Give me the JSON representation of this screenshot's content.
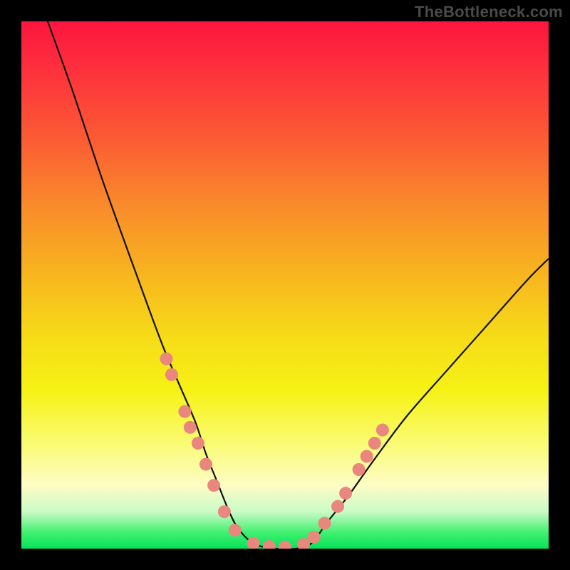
{
  "watermark": {
    "text": "TheBottleneck.com"
  },
  "colors": {
    "background": "#000000",
    "curve": "#111111",
    "marker_fill": "#e9867e",
    "marker_stroke": "#c25a52"
  },
  "chart_data": {
    "type": "line",
    "title": "",
    "xlabel": "",
    "ylabel": "",
    "xlim": [
      0,
      1
    ],
    "ylim": [
      0,
      100
    ],
    "grid": false,
    "legend": false,
    "note": "Axes are unlabeled in the source image; values below are estimated from pixel positions. x is normalized 0–1 across the plot width, y is bottleneck percentage (0 at bottom / green, 100 at top / red).",
    "series": [
      {
        "name": "bottleneck-curve",
        "x": [
          0.05,
          0.1,
          0.15,
          0.2,
          0.24,
          0.27,
          0.3,
          0.33,
          0.35,
          0.37,
          0.39,
          0.41,
          0.44,
          0.48,
          0.52,
          0.55,
          0.58,
          0.62,
          0.67,
          0.73,
          0.8,
          0.88,
          0.96,
          1.0
        ],
        "y": [
          100,
          86,
          71,
          57,
          46,
          38,
          31,
          24,
          18,
          13,
          8,
          4,
          1,
          0,
          0,
          1,
          5,
          10,
          17,
          25,
          33,
          42,
          51,
          55
        ]
      }
    ],
    "markers": {
      "name": "highlighted-points",
      "note": "Salmon circular markers overlaid on the curve near the valley; approximate (x, y) pairs.",
      "points": [
        [
          0.275,
          36
        ],
        [
          0.285,
          33
        ],
        [
          0.31,
          26
        ],
        [
          0.32,
          23
        ],
        [
          0.335,
          20
        ],
        [
          0.35,
          16
        ],
        [
          0.365,
          12
        ],
        [
          0.385,
          7
        ],
        [
          0.405,
          3.5
        ],
        [
          0.44,
          1
        ],
        [
          0.47,
          0.4
        ],
        [
          0.5,
          0.3
        ],
        [
          0.535,
          0.8
        ],
        [
          0.555,
          2.2
        ],
        [
          0.575,
          4.8
        ],
        [
          0.6,
          8
        ],
        [
          0.615,
          10.5
        ],
        [
          0.64,
          15
        ],
        [
          0.655,
          17.5
        ],
        [
          0.67,
          20
        ],
        [
          0.685,
          22.5
        ]
      ]
    }
  }
}
